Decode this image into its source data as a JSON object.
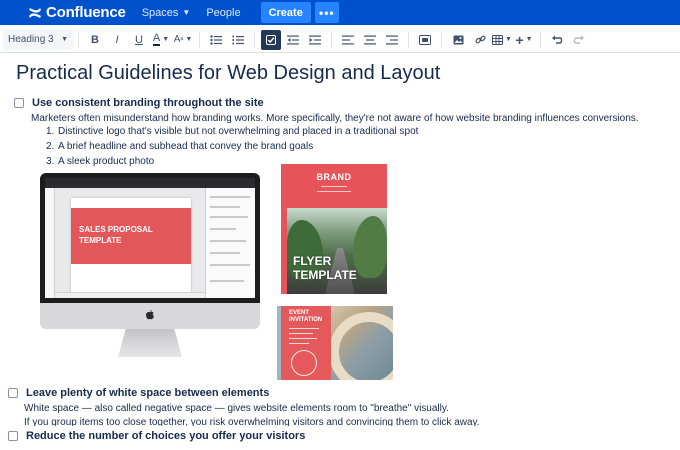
{
  "nav": {
    "logo_text": "Confluence",
    "spaces_label": "Spaces",
    "people_label": "People",
    "create_label": "Create",
    "more_label": "•••",
    "bg_color": "#0052cc"
  },
  "toolbar": {
    "text_style": "Heading 3",
    "bold": "B",
    "italic": "I",
    "underline": "U",
    "text_color": "A",
    "more_formatting": "A"
  },
  "page": {
    "title": "Practical Guidelines for Web Design and Layout",
    "tasks": [
      {
        "label": "Use consistent branding throughout the site",
        "checked": false,
        "description": "Marketers often misunderstand how branding works. More specifically, they're not aware of how website branding influences conversions.",
        "list": [
          "Distinctive logo that's visible but not overwhelming and placed in a traditional spot",
          "A brief headline and subhead that convey the brand goals",
          "A sleek product photo"
        ]
      },
      {
        "label": "Leave plenty of white space between elements",
        "checked": false,
        "description_1": "White space — also called negative space — gives website elements room to \"breathe\" visually.",
        "description_2": "If you group items too close together, you risk overwhelming visitors and convincing them to click away."
      },
      {
        "label": "Reduce the number of choices you offer your visitors",
        "checked": false
      }
    ]
  },
  "images": {
    "imac_screen_text_1": "SALES PROPOSAL",
    "imac_screen_text_2": "TEMPLATE",
    "flyer_brand": "BRAND",
    "flyer_title_1": "FLYER",
    "flyer_title_2": "TEMPLATE",
    "event_title_1": "EVENT",
    "event_title_2": "INVITATION",
    "accent_color": "#e3575a"
  }
}
